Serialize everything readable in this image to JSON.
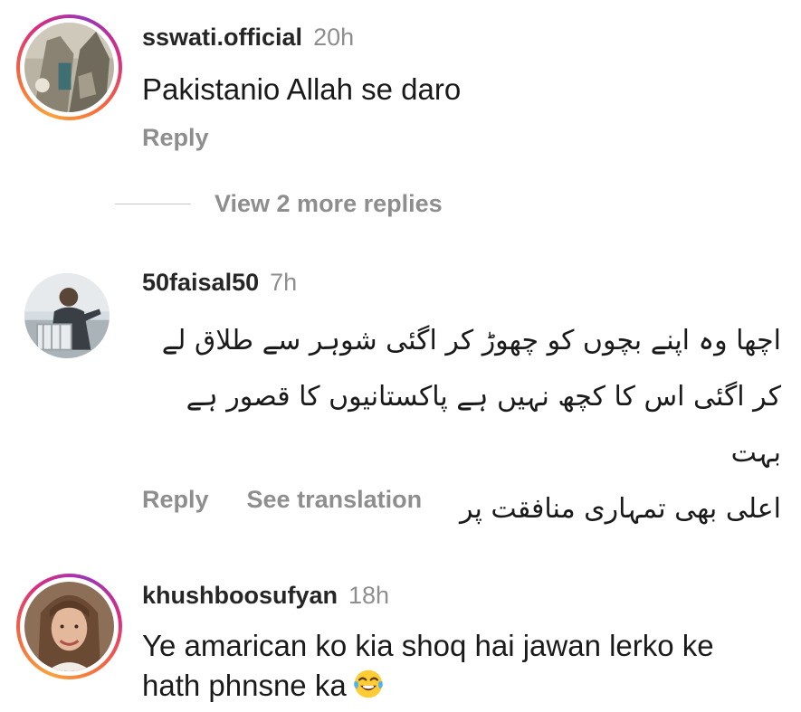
{
  "comments": [
    {
      "username": "sswati.official",
      "time": "20h",
      "text": "Pakistanio Allah se daro",
      "reply_label": "Reply",
      "view_replies_label": "View 2 more replies"
    },
    {
      "username": "50faisal50",
      "time": "7h",
      "text_lines": [
        "اچھا وہ اپنے بچوں کو چھوڑ کر اگئی شوہر سے طلاق لے",
        "کر اگئی اس کا کچھ نہیں ہے پاکستانیوں کا قصور ہے بہت",
        "اعلی بھی تمہاری منافقت پر"
      ],
      "reply_label": "Reply",
      "translation_label": "See translation"
    },
    {
      "username": "khushboosufyan",
      "time": "18h",
      "text_line1": "Ye amarican ko kia shoq hai jawan lerko ke",
      "text_line2": "hath phnsne ka",
      "emoji": "face-with-tears-of-joy-icon"
    }
  ],
  "colors": {
    "username": "#262626",
    "secondary": "#8e8e8e",
    "story_ring": [
      "#f9a23c",
      "#d92e7f",
      "#9b36b7"
    ]
  }
}
